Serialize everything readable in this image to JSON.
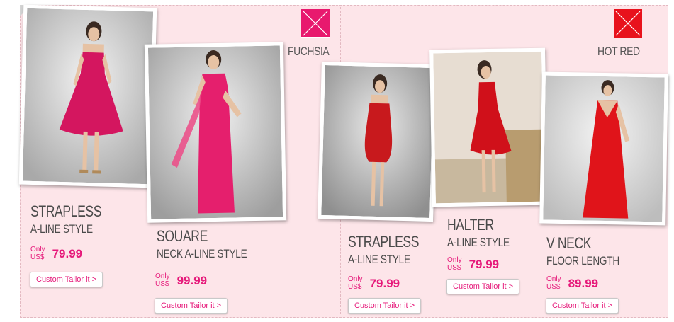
{
  "sections": [
    {
      "color_name": "FUCHSIA",
      "swatch_color": "#e8196e"
    },
    {
      "color_name": "HOT RED",
      "swatch_color": "#e8121c"
    }
  ],
  "products": [
    {
      "line1": "STRAPLESS",
      "line2": "A-LINE STYLE",
      "only": "Only",
      "currency": "US$",
      "price": "79.99",
      "cta": "Custom Tailor it >",
      "dress_color": "#d4165f"
    },
    {
      "line1": "SOUARE",
      "line2": "NECK A-LINE STYLE",
      "only": "Only",
      "currency": "US$",
      "price": "99.99",
      "cta": "Custom Tailor it >",
      "dress_color": "#e51f6d"
    },
    {
      "line1": "STRAPLESS",
      "line2": "A-LINE STYLE",
      "only": "Only",
      "currency": "US$",
      "price": "79.99",
      "cta": "Custom Tailor it >",
      "dress_color": "#c8191d"
    },
    {
      "line1": "HALTER",
      "line2": "A-LINE STYLE",
      "only": "Only",
      "currency": "US$",
      "price": "79.99",
      "cta": "Custom Tailor it >",
      "dress_color": "#d0101a"
    },
    {
      "line1": "V NECK",
      "line2": "FLOOR LENGTH",
      "only": "Only",
      "currency": "US$",
      "price": "89.99",
      "cta": "Custom Tailor it >",
      "dress_color": "#e0141a"
    }
  ]
}
